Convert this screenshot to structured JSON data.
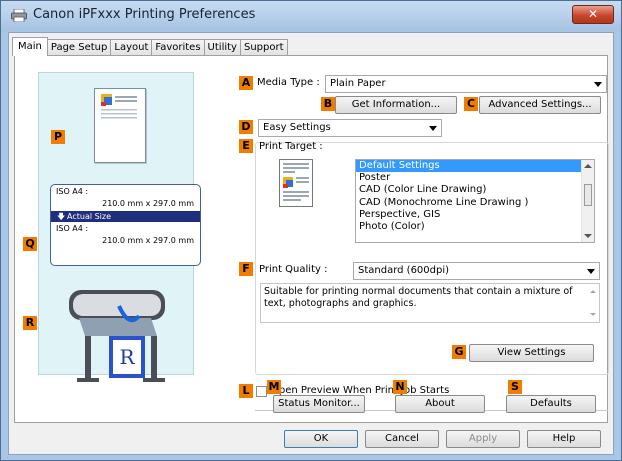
{
  "window": {
    "title": "Canon iPFxxx Printing Preferences",
    "close_glyph": "✕"
  },
  "tabs": [
    {
      "label": "Main"
    },
    {
      "label": "Page Setup"
    },
    {
      "label": "Layout"
    },
    {
      "label": "Favorites"
    },
    {
      "label": "Utility"
    },
    {
      "label": "Support"
    }
  ],
  "preview": {
    "size_label_1": "ISO A4 :",
    "size_value_1": "210.0 mm x 297.0 mm",
    "actual_size": "Actual Size",
    "size_label_2": "ISO A4 :",
    "size_value_2": "210.0 mm x 297.0 mm"
  },
  "callouts": {
    "A": "A",
    "B": "B",
    "C": "C",
    "D": "D",
    "E": "E",
    "F": "F",
    "G": "G",
    "L": "L",
    "M": "M",
    "N": "N",
    "S": "S",
    "P": "P",
    "Q": "Q",
    "R": "R"
  },
  "media_type": {
    "label": "Media Type :",
    "value": "Plain Paper"
  },
  "buttons": {
    "get_information": "Get Information...",
    "advanced_settings": "Advanced Settings...",
    "view_settings": "View Settings",
    "status_monitor": "Status Monitor...",
    "about": "About",
    "defaults": "Defaults",
    "ok": "OK",
    "cancel": "Cancel",
    "apply": "Apply",
    "help": "Help"
  },
  "mode": {
    "value": "Easy Settings"
  },
  "print_target": {
    "label": "Print Target :",
    "items": [
      "Default Settings",
      "Poster",
      "CAD (Color Line Drawing)",
      "CAD (Monochrome Line Drawing )",
      "Perspective, GIS",
      "Photo (Color)"
    ],
    "selected": "Default Settings"
  },
  "print_quality": {
    "label": "Print Quality :",
    "value": "Standard (600dpi)",
    "description": "Suitable for printing normal documents that contain a mixture of text, photographs and graphics."
  },
  "open_preview": {
    "label": "Open Preview When Print Job Starts",
    "checked": false
  },
  "colors": {
    "accent": "#f07c00",
    "selection": "#3399ff",
    "title_bar": "#a9c6e6"
  }
}
